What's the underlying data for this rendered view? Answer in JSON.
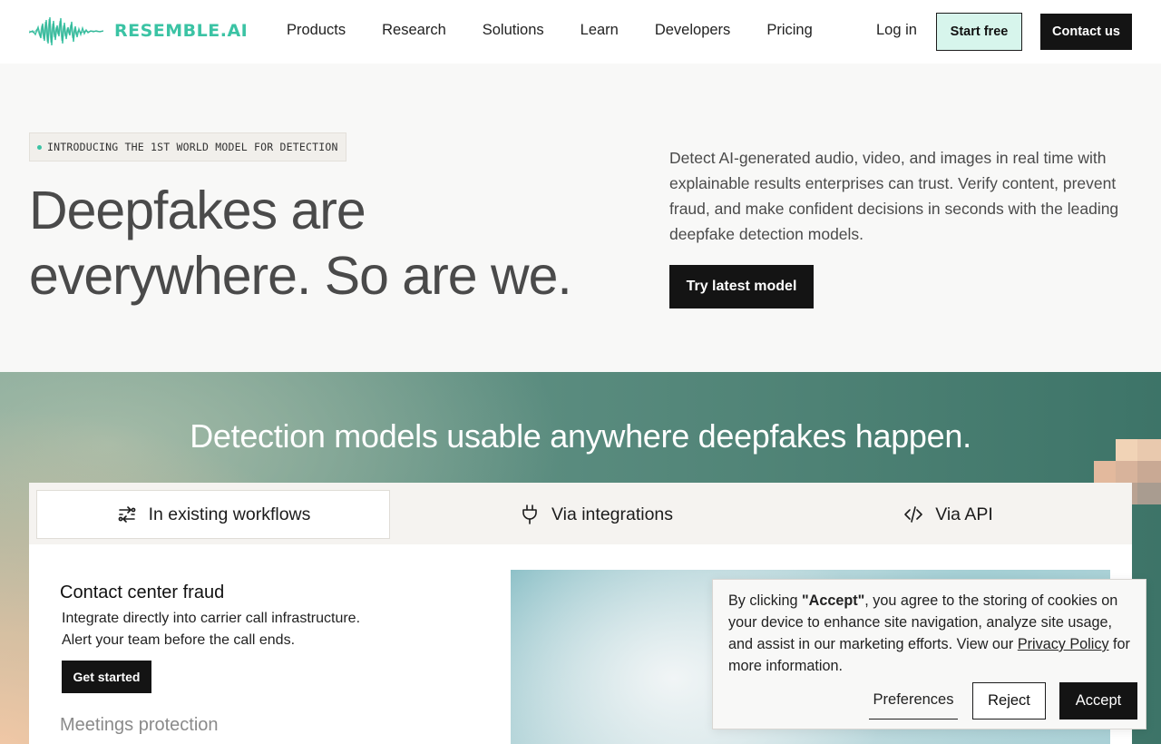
{
  "nav": {
    "logo_text": "RESEMBLE.AI",
    "logo_icon": "waveform-icon",
    "links": [
      "Products",
      "Research",
      "Solutions",
      "Learn",
      "Developers",
      "Pricing"
    ],
    "login": "Log in",
    "start_free": "Start free",
    "contact": "Contact us"
  },
  "hero": {
    "badge": "INTRODUCING THE 1ST WORLD MODEL FOR DETECTION",
    "title_line1": "Deepfakes are",
    "title_line2": "everywhere. So are we.",
    "description": "Detect AI-generated audio, video, and images in real time with explainable results enterprises can trust. Verify content, prevent fraud, and make confident decisions in seconds with the leading deepfake detection models.",
    "cta": "Try latest model"
  },
  "section": {
    "title": "Detection models usable anywhere deepfakes happen.",
    "tabs": [
      {
        "label": "In existing workflows",
        "icon": "workflow-icon",
        "active": true
      },
      {
        "label": "Via integrations",
        "icon": "plug-icon",
        "active": false
      },
      {
        "label": "Via API",
        "icon": "code-icon",
        "active": false
      }
    ],
    "case_title": "Contact center fraud",
    "case_desc_line1": "Integrate directly into carrier call infrastructure.",
    "case_desc_line2": "Alert your team before the call ends.",
    "case_cta": "Get started",
    "next_case": "Meetings protection"
  },
  "cookie": {
    "text_pre": "By clicking ",
    "text_bold": "\"Accept\"",
    "text_mid": ", you agree to the storing of cookies on your device to enhance site navigation, analyze site usage, and assist in our marketing efforts. View our ",
    "link": "Privacy Policy",
    "text_post": " for more information.",
    "preferences": "Preferences",
    "reject": "Reject",
    "accept": "Accept"
  },
  "colors": {
    "brand": "#3bc3a4",
    "dark": "#141414",
    "start_free_bg": "#d7f5ec"
  }
}
